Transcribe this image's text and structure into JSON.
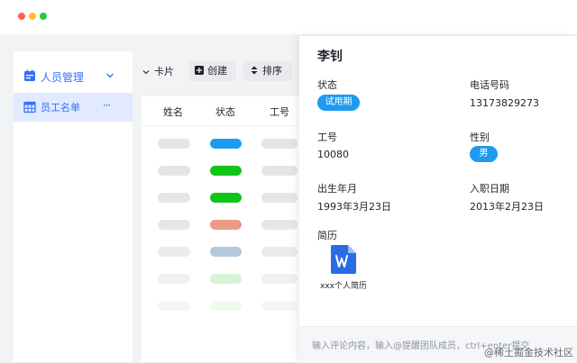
{
  "window": {
    "controls": [
      {
        "name": "close",
        "color": "#ff5f56"
      },
      {
        "name": "minimize",
        "color": "#ffbd2e"
      },
      {
        "name": "maximize",
        "color": "#27c93f"
      }
    ]
  },
  "sidebar": {
    "group": {
      "label": "人员管理",
      "icon": "calendar-icon",
      "chevron": "chevron-down-icon"
    },
    "items": [
      {
        "label": "员工名单",
        "icon": "table-icon",
        "more": "···"
      }
    ]
  },
  "toolbar": {
    "view_label": "卡片",
    "create_label": "创建",
    "sort_label": "排序"
  },
  "grid": {
    "columns": [
      "姓名",
      "状态",
      "工号"
    ],
    "row_status_colors": [
      "#1e9bf0",
      "#11c418",
      "#11c418",
      "#e9907a",
      "#9bb6d4",
      "#b3ecb3",
      "#d7f4d7"
    ],
    "row_opacity": [
      1,
      1,
      1,
      0.9,
      0.75,
      0.55,
      0.35
    ]
  },
  "detail": {
    "name": "李钊",
    "fields": {
      "status": {
        "label": "状态",
        "value": "试用期"
      },
      "phone": {
        "label": "电话号码",
        "value": "13173829273"
      },
      "employee_id": {
        "label": "工号",
        "value": "10080"
      },
      "gender": {
        "label": "性别",
        "value": "男"
      },
      "birth": {
        "label": "出生年月",
        "value": "1993年3月23日"
      },
      "hire_date": {
        "label": "入职日期",
        "value": "2013年2月23日"
      },
      "resume": {
        "label": "简历",
        "file_name": "xxx个人简历",
        "file_icon": "word-doc-icon"
      }
    },
    "comment_placeholder": "输入评论内容，输入@提醒团队成员，ctrl+enter提交"
  },
  "watermark": "@稀土掘金技术社区",
  "colors": {
    "accent": "#3370ff",
    "tag": "#1e9bf0",
    "doc_icon": "#2b6ce6"
  }
}
